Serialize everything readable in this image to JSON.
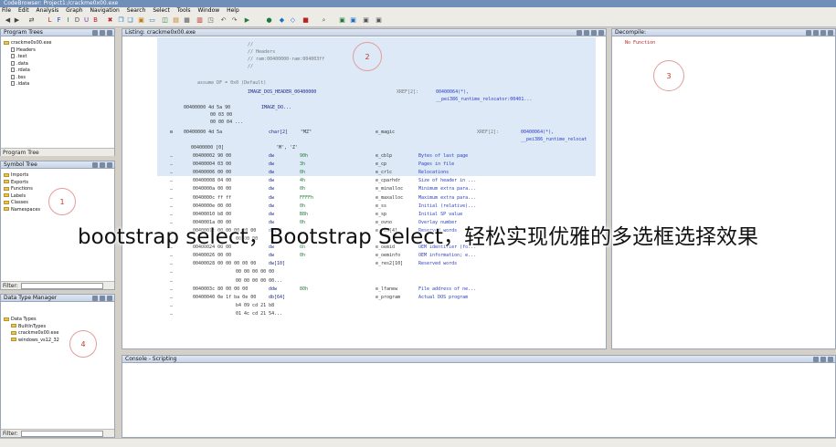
{
  "window": {
    "title": "CodeBrowser: Project1:/crackme0x00.exe"
  },
  "menu": [
    "File",
    "Edit",
    "Analysis",
    "Graph",
    "Navigation",
    "Search",
    "Select",
    "Tools",
    "Window",
    "Help"
  ],
  "program_trees": {
    "title": "Program Trees",
    "root": "crackme0x00.exe",
    "items": [
      "Headers",
      ".text",
      ".data",
      ".rdata",
      ".bss",
      ".idata"
    ],
    "footer_tab": "Program Tree"
  },
  "symbol_tree": {
    "title": "Symbol Tree",
    "items": [
      "Imports",
      "Exports",
      "Functions",
      "Labels",
      "Classes",
      "Namespaces"
    ],
    "filter_label": "Filter:"
  },
  "data_type_manager": {
    "title": "Data Type Manager",
    "root": "Data Types",
    "items": [
      "BuiltInTypes",
      "crackme0x00.exe",
      "windows_vs12_32"
    ],
    "filter_label": "Filter:"
  },
  "listing": {
    "title": "Listing:  crackme0x00.exe",
    "comment_lines": [
      "//",
      "// Headers",
      "// ram:00400000-ram:004003ff",
      "//"
    ],
    "assume_line": "assume DF = 0x0  (Default)",
    "image_header_label": "IMAGE_DOS_HEADER_00400000",
    "xref_label": "XREF[2]:",
    "xref_target_1": "00400064(*),",
    "xref_target_2": "__pei386_runtime_relocator:00401...",
    "first_bytes": [
      "00400000 4d 5a 90",
      "00 03 00",
      "00 00 04 ..."
    ],
    "image_dos_label": "IMAGE_DO...",
    "struct_row": {
      "addr": "00400000 4d 5a",
      "type": "char[2]",
      "value": "\"MZ\"",
      "field": "e_magic",
      "xref": "XREF[2]:",
      "xref_1": "00400064(*),",
      "xref_2": "__pei386_runtime_relocat"
    },
    "sub_row": {
      "addr": "00400000 [0]",
      "value": "'M', 'Z'"
    },
    "rows": [
      {
        "addr": "00400002 90 00",
        "type": "dw",
        "value": "90h",
        "field": "e_cblp",
        "comment": "Bytes of last page"
      },
      {
        "addr": "00400004 03 00",
        "type": "dw",
        "value": "3h",
        "field": "e_cp",
        "comment": "Pages in file"
      },
      {
        "addr": "00400006 00 00",
        "type": "dw",
        "value": "0h",
        "field": "e_crlc",
        "comment": "Relocations"
      },
      {
        "addr": "00400008 04 00",
        "type": "dw",
        "value": "4h",
        "field": "e_cparhdr",
        "comment": "Size of header in ..."
      },
      {
        "addr": "0040000a 00 00",
        "type": "dw",
        "value": "0h",
        "field": "e_minalloc",
        "comment": "Minimum extra para..."
      },
      {
        "addr": "0040000c ff ff",
        "type": "dw",
        "value": "FFFFh",
        "field": "e_maxalloc",
        "comment": "Maximum extra para..."
      },
      {
        "addr": "0040000e 00 00",
        "type": "dw",
        "value": "0h",
        "field": "e_ss",
        "comment": "Initial (relative)..."
      },
      {
        "addr": "00400010 b8 00",
        "type": "dw",
        "value": "B8h",
        "field": "e_sp",
        "comment": "Initial SP value"
      },
      {
        "addr": "0040001a 00 00",
        "type": "dw",
        "value": "0h",
        "field": "e_ovno",
        "comment": "Overlay number"
      },
      {
        "addr": "0040001c 00 00 00 00 00",
        "type": "dw[4]",
        "value": "",
        "field": "e_res[4]",
        "comment": "Reserved words"
      },
      {
        "addr": "00 00 00",
        "type": "",
        "value": "",
        "field": "",
        "comment": ""
      },
      {
        "addr": "00400024 00 00",
        "type": "dw",
        "value": "0h",
        "field": "e_oemid",
        "comment": "OEM identifier (fo..."
      },
      {
        "addr": "00400026 00 00",
        "type": "dw",
        "value": "0h",
        "field": "e_oeminfo",
        "comment": "OEM information; e..."
      },
      {
        "addr": "00400028 00 00 00 00 00",
        "type": "dw[10]",
        "value": "",
        "field": "e_res2[10]",
        "comment": "Reserved words"
      },
      {
        "addr": "00 00 00 00 00",
        "type": "",
        "value": "",
        "field": "",
        "comment": ""
      },
      {
        "addr": "00 00 00 00 00...",
        "type": "",
        "value": "",
        "field": "",
        "comment": ""
      },
      {
        "addr": "0040003c 80 00 00 00",
        "type": "ddw",
        "value": "80h",
        "field": "e_lfanew",
        "comment": "File address of ne..."
      },
      {
        "addr": "00400040 0e 1f ba 0e 00",
        "type": "db[64]",
        "value": "",
        "field": "e_program",
        "comment": "Actual DOS program"
      },
      {
        "addr": "b4 09 cd 21 b8",
        "type": "",
        "value": "",
        "field": "",
        "comment": ""
      },
      {
        "addr": "01 4c cd 21 54...",
        "type": "",
        "value": "",
        "field": "",
        "comment": ""
      }
    ]
  },
  "decompiler": {
    "title": "Decompile:",
    "message": "No Function"
  },
  "console": {
    "title": "Console - Scripting"
  },
  "overlay_text": "bootstrap select，Bootstrap Select，轻松实现优雅的多选框选择效果",
  "annotations": [
    "1",
    "2",
    "3",
    "4"
  ],
  "colors": {
    "header_bg": "#dde9f7",
    "accent": "#2a3fc5",
    "annotation": "#c23b22"
  }
}
